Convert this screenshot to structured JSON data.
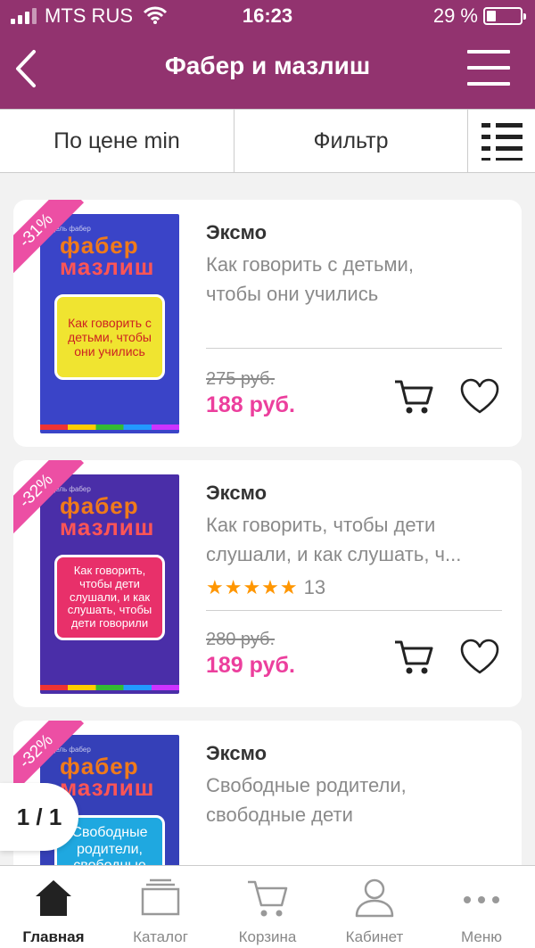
{
  "status_bar": {
    "carrier": "MTS RUS",
    "time": "16:23",
    "battery": "29 %"
  },
  "header": {
    "title": "Фабер и мазлиш"
  },
  "toolbar": {
    "sort_label": "По цене min",
    "filter_label": "Фильтр"
  },
  "colors": {
    "header_bg": "#92336f",
    "price": "#ec3f9d",
    "ribbon": "#ec4fa4",
    "star": "#ff9600"
  },
  "products": [
    {
      "discount": "-31%",
      "publisher": "Эксмо",
      "title_line1": "Как говорить с детьми,",
      "title_line2": "чтобы они учились",
      "old_price": "275 руб.",
      "price": "188 руб.",
      "cover": {
        "author": "адель фабер",
        "word1": "фабер",
        "word2": "мазлиш",
        "box_text": "Как говорить с детьми, чтобы они учились"
      }
    },
    {
      "discount": "-32%",
      "publisher": "Эксмо",
      "title_line1": "Как говорить, чтобы дети",
      "title_line2": "слушали, и как слушать, ч...",
      "stars": "★★★★★",
      "rating_count": "13",
      "old_price": "280 руб.",
      "price": "189 руб.",
      "cover": {
        "author": "адель фабер",
        "word1": "фабер",
        "word2": "мазлиш",
        "box_text": "Как говорить, чтобы дети слушали, и как слушать, чтобы дети говорили"
      }
    },
    {
      "discount": "-32%",
      "publisher": "Эксмо",
      "title_line1": "Свободные родители,",
      "title_line2": "свободные дети",
      "cover": {
        "author": "адель фабер",
        "word1": "фабер",
        "word2": "мазлиш",
        "box_text": "Свободные родители, свободные дети"
      }
    }
  ],
  "pager": {
    "text": "1 / 1"
  },
  "tabbar": {
    "home": "Главная",
    "catalog": "Каталог",
    "cart": "Корзина",
    "account": "Кабинет",
    "menu": "Меню"
  }
}
